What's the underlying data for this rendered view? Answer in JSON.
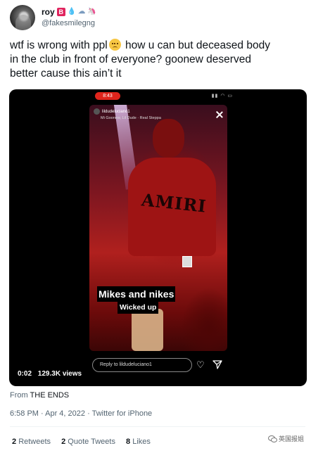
{
  "author": {
    "display_name": "roy",
    "badge_letter": "B",
    "handle": "@fakesmilegng"
  },
  "tweet": {
    "text_line1_a": "wtf is wrong with ppl",
    "text_line1_b": " how u can but deceased body",
    "text_line2": "in the club in front of everyone? goonew deserved",
    "text_line3": "better cause this ain’t it",
    "emoji": "woozy-face"
  },
  "media": {
    "phone_time": "8:43",
    "story_user": "lildudeluciano1",
    "story_song": "Mi Goonew, Lil Dude · Real Steppa",
    "caption_1": "Mikes and nikes",
    "caption_2": "Wicked up",
    "reply_placeholder": "Reply to lildudeluciano1",
    "duration": "0:02",
    "views": "129.3K views",
    "shirt_text": "AMIRI"
  },
  "source": {
    "label": "From",
    "name": "THE ENDS"
  },
  "meta": {
    "timestamp": "6:58 PM · Apr 4, 2022 · Twitter for iPhone"
  },
  "stats": {
    "retweets_count": "2",
    "retweets_label": "Retweets",
    "quotes_count": "2",
    "quotes_label": "Quote Tweets",
    "likes_count": "8",
    "likes_label": "Likes"
  },
  "watermark": {
    "text": "英国报姐"
  },
  "colors": {
    "text": "#0f1419",
    "secondary": "#536471",
    "badge": "#e0245e",
    "divider": "#eff3f4"
  }
}
